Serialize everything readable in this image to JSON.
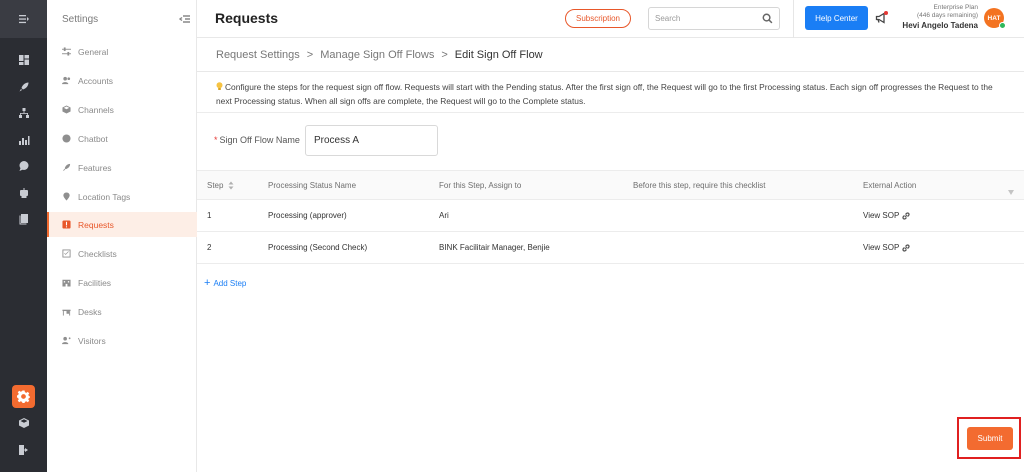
{
  "sidebar": {
    "title": "Settings",
    "items": [
      {
        "label": "General",
        "icon": "sliders-icon"
      },
      {
        "label": "Accounts",
        "icon": "users-icon"
      },
      {
        "label": "Channels",
        "icon": "cube-icon"
      },
      {
        "label": "Chatbot",
        "icon": "chat-icon"
      },
      {
        "label": "Features",
        "icon": "rocket-icon"
      },
      {
        "label": "Location Tags",
        "icon": "pin-icon"
      },
      {
        "label": "Requests",
        "icon": "alert-icon",
        "active": true
      },
      {
        "label": "Checklists",
        "icon": "checklist-icon"
      },
      {
        "label": "Facilities",
        "icon": "building-icon"
      },
      {
        "label": "Desks",
        "icon": "desk-icon"
      },
      {
        "label": "Visitors",
        "icon": "visitor-icon"
      }
    ]
  },
  "header": {
    "title": "Requests",
    "subscription_label": "Subscription",
    "search_placeholder": "Search",
    "help_label": "Help Center",
    "plan": "Enterprise Plan",
    "days_remaining": "(446 days remaining)",
    "user_name": "Hevi Angelo Tadena",
    "avatar_initials": "HAT"
  },
  "breadcrumb": {
    "items": [
      "Request Settings",
      "Manage Sign Off Flows",
      "Edit Sign Off Flow"
    ],
    "separator": ">"
  },
  "info": {
    "text": "Configure the steps for the request sign off flow. Requests will start with the Pending status. After the first sign off, the Request will go to the first Processing status. Each sign off progresses the Request to the next Processing status. When all sign offs are complete, the Request will go to the Complete status."
  },
  "form": {
    "name_label": "Sign Off Flow Name",
    "required_mark": "*",
    "name_value": "Process A"
  },
  "table": {
    "columns": [
      "Step",
      "Processing Status Name",
      "For this Step, Assign to",
      "Before this step, require this checklist",
      "External Action"
    ],
    "rows": [
      {
        "step": "1",
        "status": "Processing (approver)",
        "assign": "Ari",
        "checklist": "",
        "action": "View SOP"
      },
      {
        "step": "2",
        "status": "Processing (Second Check)",
        "assign": "BINK Facilitair Manager, Benjie",
        "checklist": "",
        "action": "View SOP"
      }
    ]
  },
  "actions": {
    "add_step": "Add Step",
    "add_step_plus": "+",
    "submit": "Submit"
  },
  "colors": {
    "accent": "#f36b30",
    "primary_blue": "#1a7ef5",
    "highlight_red": "#e02020",
    "rail_bg": "#2b2d33"
  }
}
